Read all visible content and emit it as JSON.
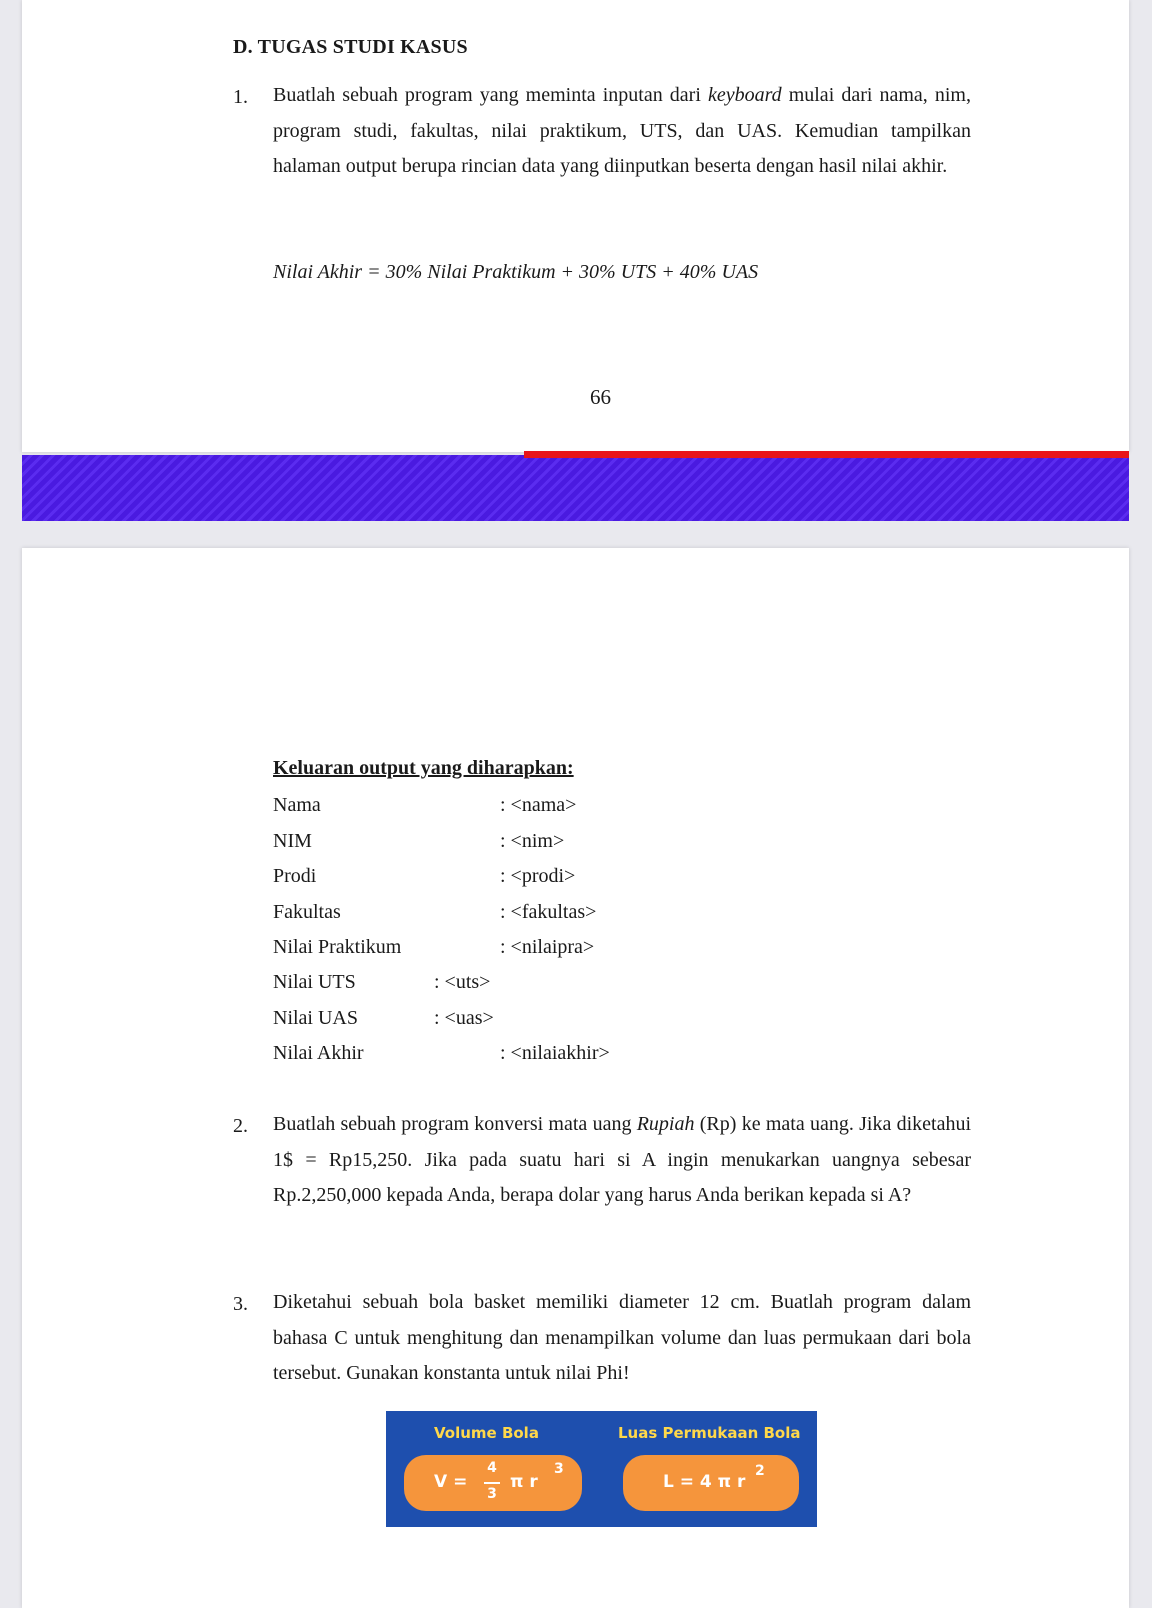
{
  "section": {
    "heading": "D.  TUGAS STUDI KASUS"
  },
  "task1": {
    "number": "1.",
    "text_a": "Buatlah sebuah program yang meminta inputan dari ",
    "text_italic": "keyboard",
    "text_b": " mulai dari nama, nim, program studi, fakultas, nilai praktikum, UTS, dan UAS. Kemudian tampilkan halaman output berupa rincian data yang diinputkan beserta dengan hasil nilai akhir.",
    "formula": "Nilai Akhir = 30% Nilai Praktikum + 30% UTS + 40% UAS"
  },
  "page_number": "66",
  "output": {
    "title": "Keluaran output yang diharapkan:",
    "rows": [
      {
        "label": "Nama",
        "value": ": <nama>"
      },
      {
        "label": "NIM",
        "value": ": <nim>"
      },
      {
        "label": "Prodi",
        "value": ": <prodi>"
      },
      {
        "label": "Fakultas",
        "value": ": <fakultas>"
      },
      {
        "label": "Nilai Praktikum",
        "value": ": <nilaipra>"
      },
      {
        "label": "Nilai UTS",
        "value": ": <uts>"
      },
      {
        "label": "Nilai UAS",
        "value": ": <uas>"
      },
      {
        "label": "Nilai Akhir",
        "value": ": <nilaiakhir>"
      }
    ]
  },
  "task2": {
    "number": "2.",
    "text_a": "Buatlah sebuah program konversi mata uang ",
    "text_italic": "Rupiah",
    "text_b": " (Rp) ke mata uang. Jika diketahui 1$ = Rp15,250. Jika pada suatu hari si A ingin menukarkan uangnya sebesar Rp.2,250,000 kepada Anda, berapa dolar yang harus Anda berikan kepada si A?"
  },
  "task3": {
    "number": "3.",
    "text": "Diketahui sebuah bola basket memiliki diameter 12 cm. Buatlah program dalam bahasa C untuk menghitung dan menampilkan volume dan luas permukaan dari bola tersebut. Gunakan konstanta untuk nilai Phi!"
  },
  "formula_box": {
    "volume_title": "Volume Bola",
    "area_title": "Luas Permukaan Bola",
    "volume_lhs": "V =",
    "volume_num": "4",
    "volume_den": "3",
    "volume_rest": "π r",
    "volume_exp": "3",
    "area_expr": "L = 4 π r",
    "area_exp": "2"
  },
  "colors": {
    "footer_stripe": "#4a1ae0",
    "footer_red": "#e8141a",
    "box_bg": "#1e4fae",
    "box_title": "#ffd84a",
    "pill": "#f5953c"
  }
}
